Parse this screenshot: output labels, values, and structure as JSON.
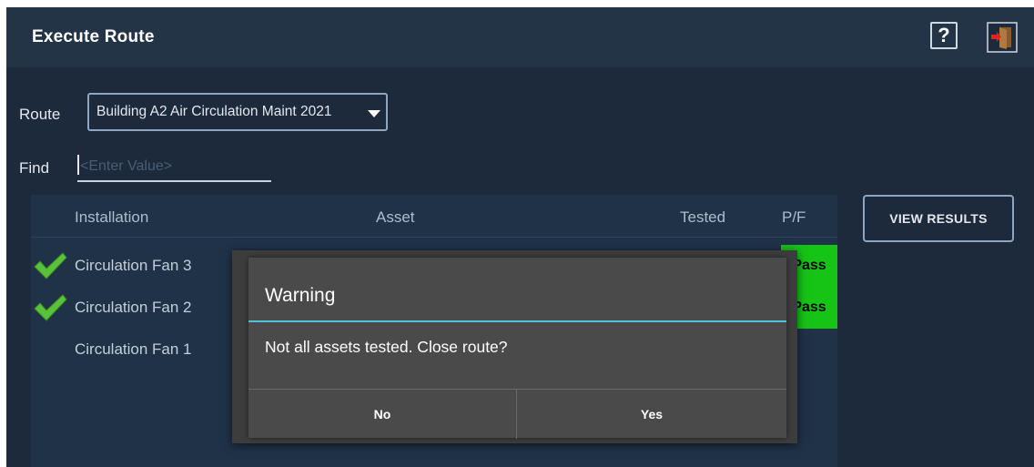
{
  "header": {
    "title": "Execute Route",
    "help_label": "?",
    "help_icon": "help-question-icon",
    "exit_icon": "exit-door-icon"
  },
  "route": {
    "label": "Route",
    "value": "Building A2 Air Circulation Maint 2021"
  },
  "find": {
    "label": "Find",
    "placeholder": "<Enter Value>",
    "value": ""
  },
  "table": {
    "columns": [
      "Installation",
      "Asset",
      "Tested",
      "P/F"
    ],
    "rows": [
      {
        "installation": "Circulation Fan 3",
        "tested_ok": true,
        "pf": "Pass"
      },
      {
        "installation": "Circulation Fan 2",
        "tested_ok": true,
        "pf": "Pass"
      },
      {
        "installation": "Circulation Fan 1",
        "tested_ok": false,
        "pf": ""
      }
    ]
  },
  "view_results_label": "VIEW RESULTS",
  "dialog": {
    "title": "Warning",
    "message": "Not all assets tested. Close route?",
    "no_label": "No",
    "yes_label": "Yes"
  },
  "colors": {
    "background": "#1c2a3b",
    "header": "#243447",
    "pass": "#16c416",
    "dialog_accent": "#4fc3d9",
    "check": "#5ac23a"
  }
}
